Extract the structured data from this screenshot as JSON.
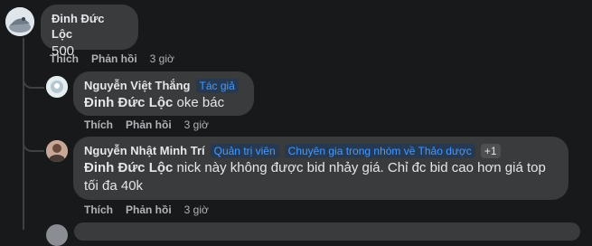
{
  "comments": [
    {
      "author": "Đinh Đức Lộc",
      "badges": [],
      "mention": "",
      "text": "500",
      "actions": {
        "like": "Thích",
        "reply": "Phản hồi",
        "time": "3 giờ"
      }
    },
    {
      "author": "Nguyễn Việt Thắng",
      "badges": [
        "Tác giả"
      ],
      "mention": "Đinh Đức Lộc",
      "text": "oke bác",
      "actions": {
        "like": "Thích",
        "reply": "Phản hồi",
        "time": "3 giờ"
      }
    },
    {
      "author": "Nguyễn Nhật Minh Trí",
      "badges": [
        "Quản trị viên",
        "Chuyên gia trong nhóm về Thảo dược",
        "+1"
      ],
      "mention": "Đinh Đức Lộc",
      "text_line1": "nick này không được bid nhảy giá. Chỉ đc bid cao hơn giá top",
      "text_line2": "tối đa 40k",
      "actions": {
        "like": "Thích",
        "reply": "Phản hồi",
        "time": "3 giờ"
      }
    }
  ],
  "colors": {
    "background": "#18191a",
    "bubble": "#3a3b3c",
    "badge_blue": "#4599ff",
    "meta_text": "#b0b3b8"
  }
}
